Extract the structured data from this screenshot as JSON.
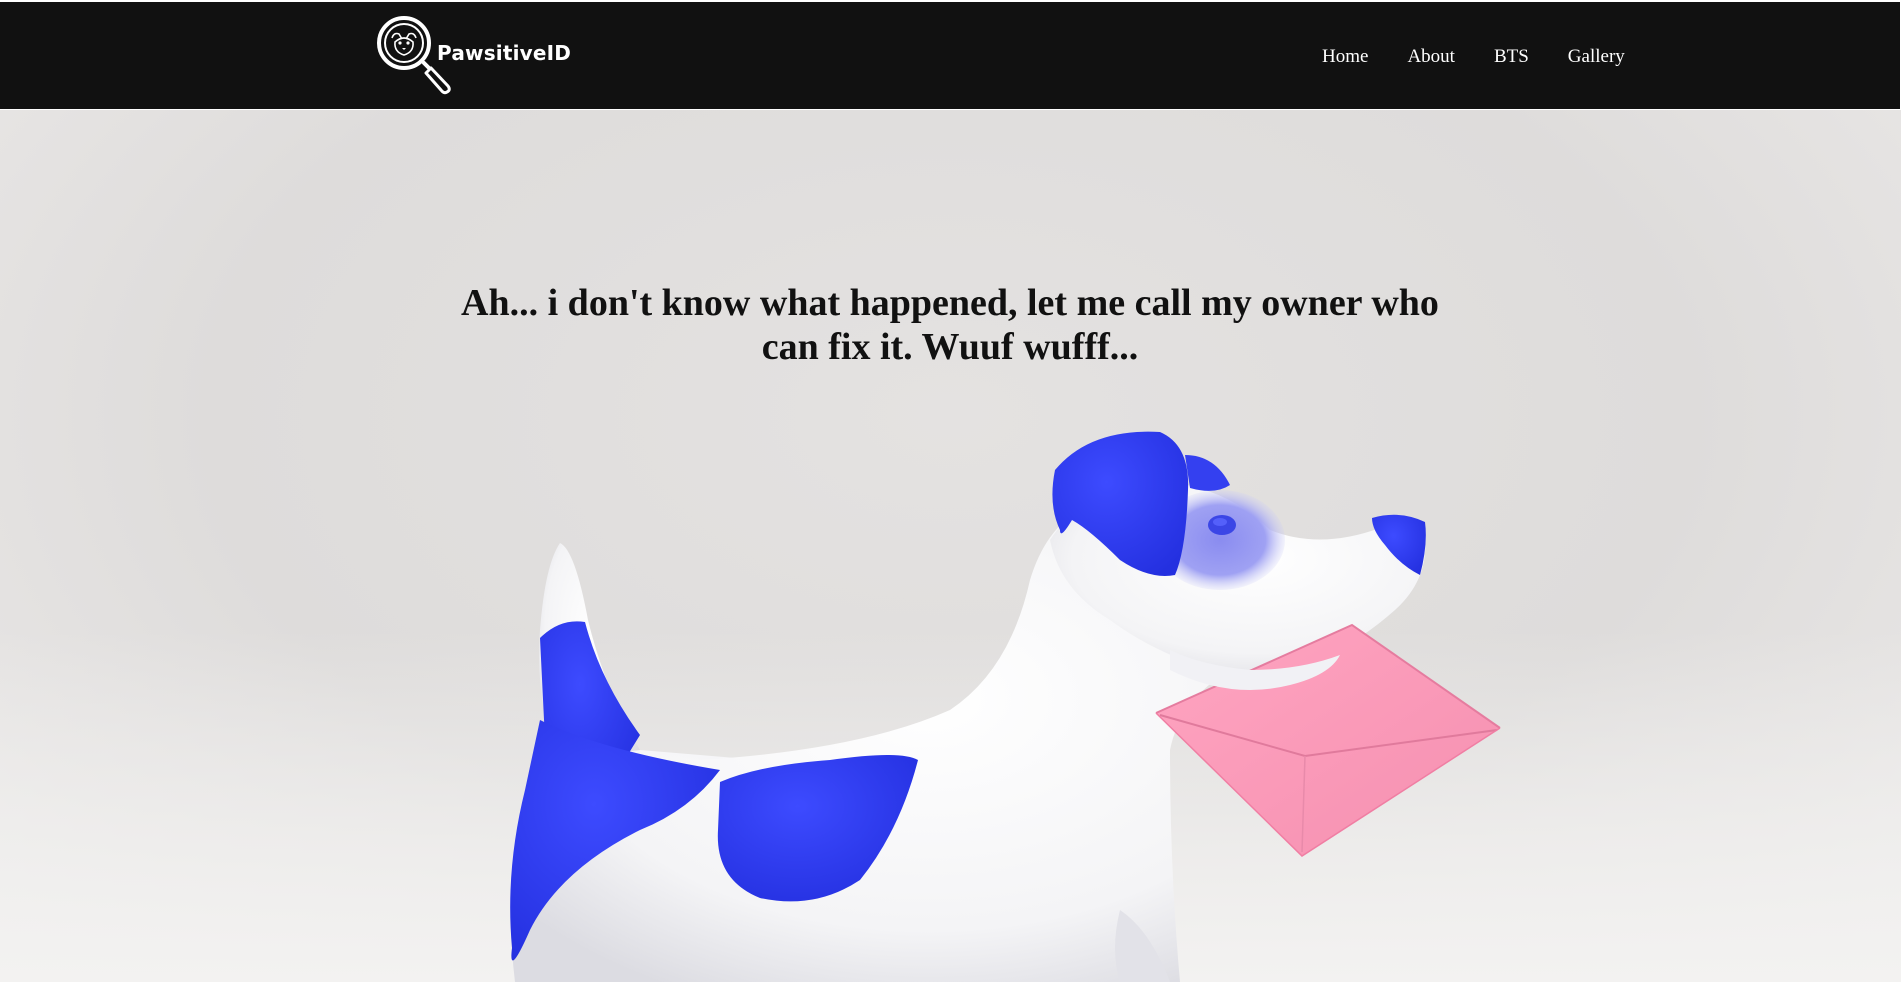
{
  "brand": {
    "name": "PawsitiveID",
    "logo_icon": "magnifier-dog-icon"
  },
  "nav": {
    "items": [
      {
        "label": "Home"
      },
      {
        "label": "About"
      },
      {
        "label": "BTS"
      },
      {
        "label": "Gallery"
      }
    ]
  },
  "hero": {
    "message": "Ah... i don't know what happened, let me call my owner who can fix it. Wuuf wufff...",
    "illustration": "dog-with-envelope-illustration"
  },
  "colors": {
    "navbar": "#111111",
    "dog_spots": "#2f3cf0",
    "envelope": "#ff9bb8",
    "background": "#e0dedd"
  }
}
